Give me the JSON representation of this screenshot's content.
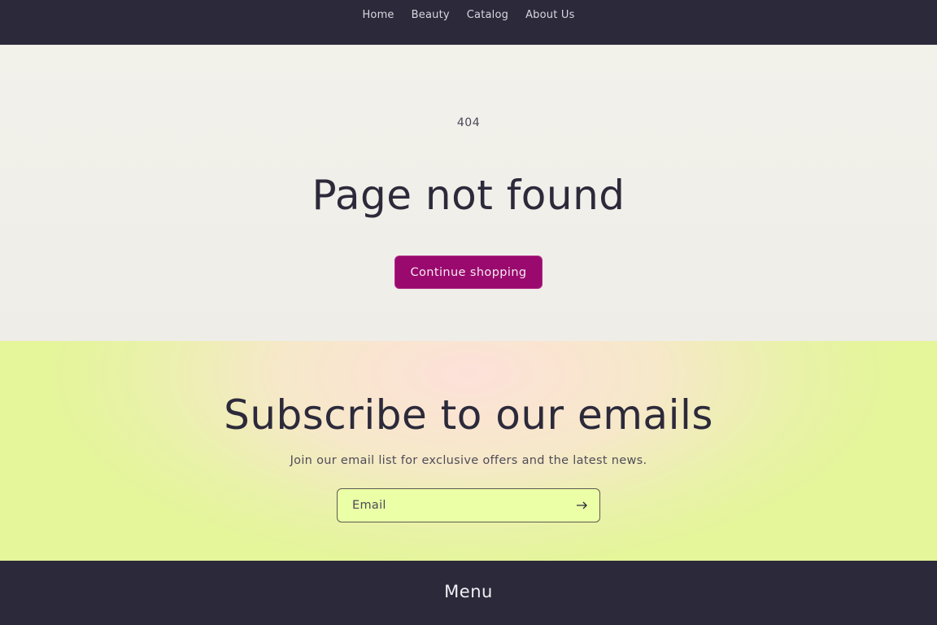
{
  "nav": {
    "items": [
      "Home",
      "Beauty",
      "Catalog",
      "About Us"
    ]
  },
  "hero": {
    "code": "404",
    "title": "Page not found",
    "button_label": "Continue shopping"
  },
  "subscribe": {
    "title": "Subscribe to our emails",
    "description": "Join our email list for exclusive offers and the latest news.",
    "email_placeholder": "Email",
    "submit_icon": "arrow-right-icon"
  },
  "footer": {
    "menu_title": "Menu"
  },
  "colors": {
    "header_bg": "#2c2a3a",
    "button_bg": "#9a0a6e",
    "input_bg": "#eaffa6"
  }
}
